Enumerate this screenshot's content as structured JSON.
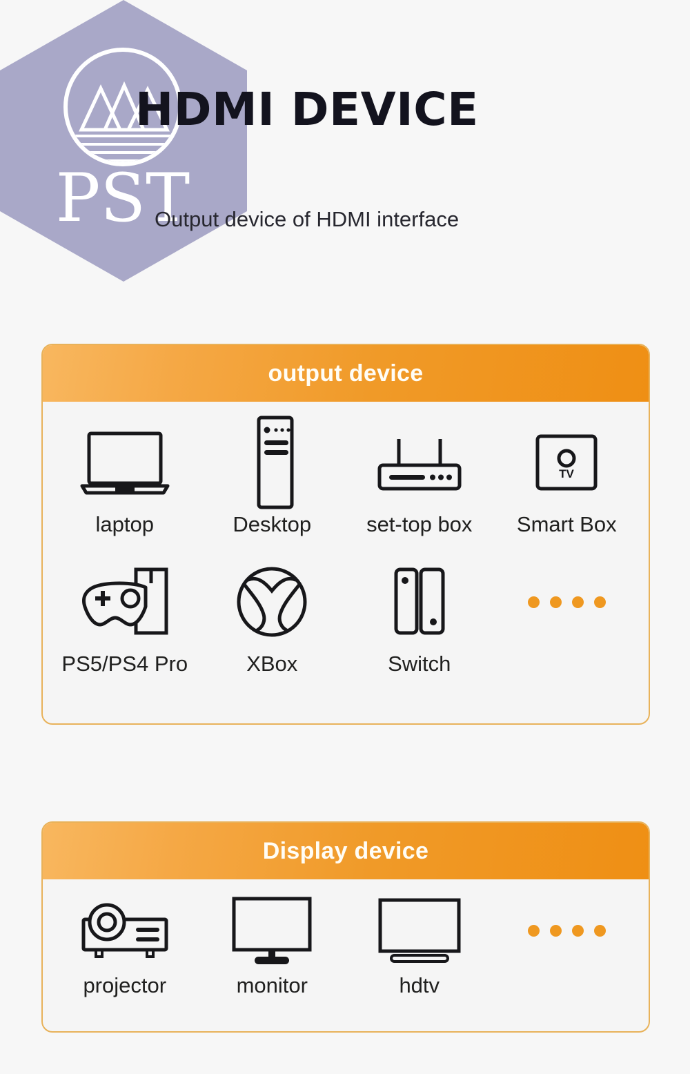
{
  "header": {
    "title": "HDMI DEVICE",
    "subtitle": "Output device of HDMI interface",
    "watermark_text": "PST",
    "watermark_icon": "mountain-water-circle-logo"
  },
  "colors": {
    "page_background": "#f7f7f7",
    "card_border": "#e8b25a",
    "card_background": "#f5f5f5",
    "header_gradient_start": "#f8b75f",
    "header_gradient_end": "#ef8f14",
    "header_text": "#fffdf6",
    "accent_dot": "#ef9820",
    "title_text": "#13131e",
    "watermark_fill": "#a9a8c8",
    "icon_stroke": "#17171a"
  },
  "sections": [
    {
      "id": "output-device",
      "title": "output device",
      "rows": [
        [
          {
            "label": "laptop",
            "icon": "laptop-icon"
          },
          {
            "label": "Desktop",
            "icon": "desktop-tower-icon"
          },
          {
            "label": "set-top box",
            "icon": "set-top-box-icon"
          },
          {
            "label": "Smart Box",
            "icon": "smart-box-icon",
            "icon_text": "TV"
          }
        ],
        [
          {
            "label": "PS5/PS4 Pro",
            "icon": "playstation-icon"
          },
          {
            "label": "XBox",
            "icon": "xbox-icon"
          },
          {
            "label": "Switch",
            "icon": "nintendo-switch-icon"
          },
          {
            "label": "",
            "icon": "more-dots-icon",
            "dots": 4
          }
        ]
      ]
    },
    {
      "id": "display-device",
      "title": "Display device",
      "rows": [
        [
          {
            "label": "projector",
            "icon": "projector-icon"
          },
          {
            "label": "monitor",
            "icon": "monitor-icon"
          },
          {
            "label": "hdtv",
            "icon": "hdtv-icon"
          },
          {
            "label": "",
            "icon": "more-dots-icon",
            "dots": 4
          }
        ]
      ]
    }
  ]
}
